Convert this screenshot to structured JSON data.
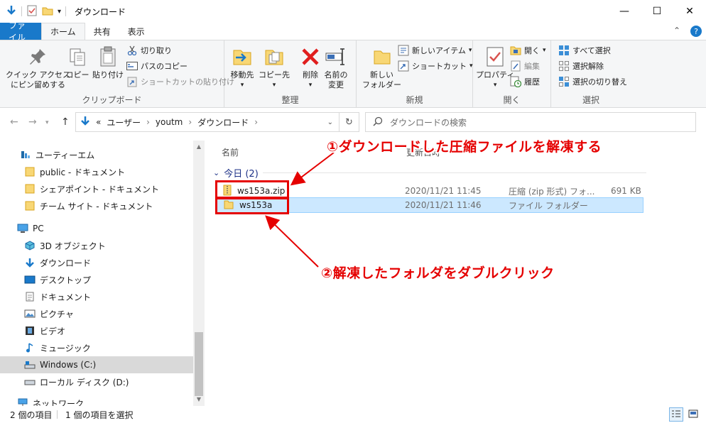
{
  "window": {
    "title": "ダウンロード",
    "minimize": "—",
    "maximize": "☐",
    "close": "✕"
  },
  "tabs": {
    "file": "ファイル",
    "home": "ホーム",
    "share": "共有",
    "view": "表示",
    "collapse": "⌃",
    "help": "?"
  },
  "ribbon": {
    "clipboard": {
      "label": "クリップボード",
      "pin_line1": "クイック アクセス",
      "pin_line2": "にピン留めする",
      "copy": "コピー",
      "paste": "貼り付け",
      "cut": "切り取り",
      "copy_path": "パスのコピー",
      "paste_shortcut": "ショートカットの貼り付け"
    },
    "organize": {
      "label": "整理",
      "move_to": "移動先",
      "copy_to": "コピー先",
      "delete": "削除",
      "rename_line1": "名前の",
      "rename_line2": "変更"
    },
    "new": {
      "label": "新規",
      "new_folder_line1": "新しい",
      "new_folder_line2": "フォルダー",
      "new_item": "新しいアイテム",
      "easy_access": "ショートカット"
    },
    "open": {
      "label": "開く",
      "properties": "プロパティ",
      "open": "開く",
      "edit": "編集",
      "history": "履歴"
    },
    "select": {
      "label": "選択",
      "select_all": "すべて選択",
      "select_none": "選択解除",
      "invert": "選択の切り替え"
    }
  },
  "address": {
    "prefix": "«",
    "crumb1": "ユーザー",
    "crumb2": "youtm",
    "crumb3": "ダウンロード",
    "search_placeholder": "ダウンロードの検索"
  },
  "nav": {
    "user": "ユーティーエム",
    "doc1": "public - ドキュメント",
    "doc2": "シェアポイント - ドキュメント",
    "doc3": "チーム サイト - ドキュメント",
    "pc": "PC",
    "objects3d": "3D オブジェクト",
    "downloads": "ダウンロード",
    "desktop": "デスクトップ",
    "documents": "ドキュメント",
    "pictures": "ピクチャ",
    "videos": "ビデオ",
    "music": "ミュージック",
    "drive_c": "Windows (C:)",
    "drive_d": "ローカル ディスク (D:)",
    "network": "ネットワーク"
  },
  "content": {
    "col_name": "名前",
    "col_date": "更新日時",
    "group_label": "今日 (2)",
    "files": [
      {
        "name": "ws153a.zip",
        "date": "2020/11/21 11:45",
        "type": "圧縮 (zip 形式) フォ...",
        "size": "691 KB"
      },
      {
        "name": "ws153a",
        "date": "2020/11/21 11:46",
        "type": "ファイル フォルダー",
        "size": ""
      }
    ]
  },
  "annotations": {
    "step1": "①ダウンロードした圧縮ファイルを解凍する",
    "step2": "②解凍したフォルダをダブルクリック",
    "color": "#e50000"
  },
  "status": {
    "count": "2 個の項目",
    "selected": "1 個の項目を選択"
  }
}
